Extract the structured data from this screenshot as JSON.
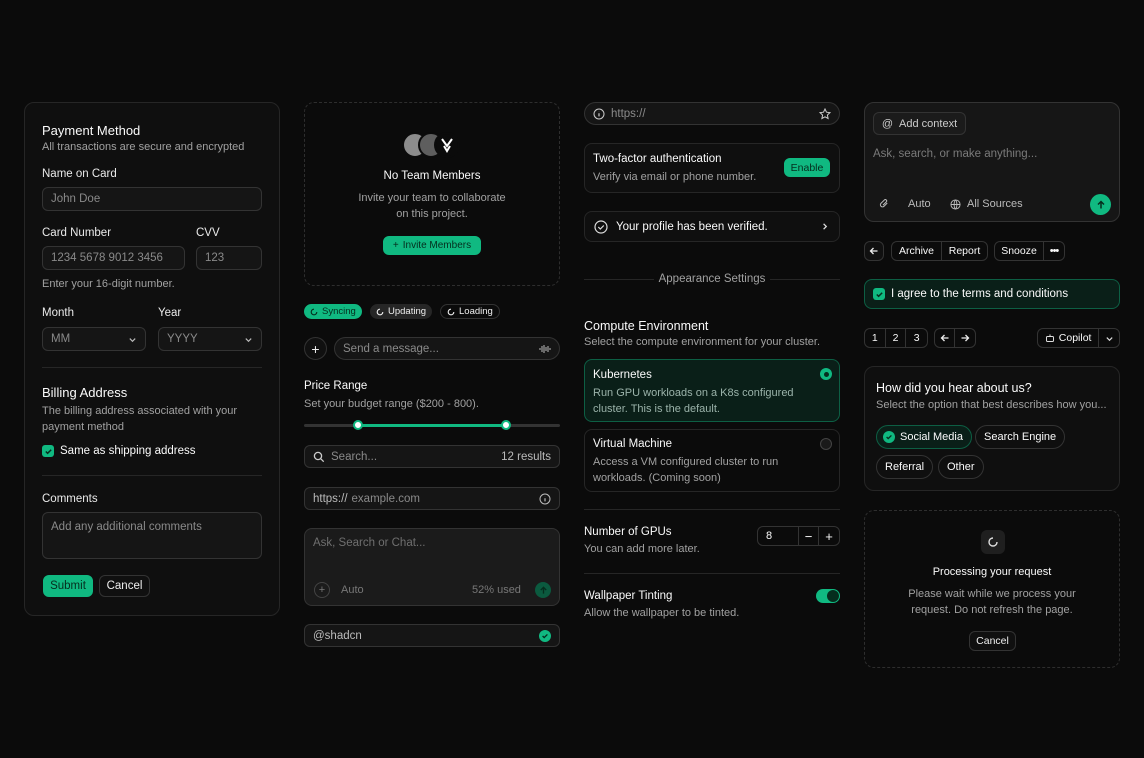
{
  "payment": {
    "title": "Payment Method",
    "subtitle": "All transactions are secure and encrypted",
    "name_label": "Name on Card",
    "name_placeholder": "John Doe",
    "card_label": "Card Number",
    "card_placeholder": "1234 5678 9012 3456",
    "cvv_label": "CVV",
    "cvv_placeholder": "123",
    "card_hint": "Enter your 16-digit number.",
    "month_label": "Month",
    "month_value": "MM",
    "year_label": "Year",
    "year_value": "YYYY",
    "billing_title": "Billing Address",
    "billing_subtitle": "The billing address associated with your payment method",
    "same_shipping": "Same as shipping address",
    "comments_label": "Comments",
    "comments_placeholder": "Add any additional comments",
    "submit": "Submit",
    "cancel": "Cancel"
  },
  "team": {
    "title": "No Team Members",
    "desc": "Invite your team to collaborate on this project.",
    "invite": "Invite Members"
  },
  "status": {
    "syncing": "Syncing",
    "updating": "Updating",
    "loading": "Loading"
  },
  "message": {
    "placeholder": "Send a message..."
  },
  "price": {
    "title": "Price Range",
    "desc": "Set your budget range ($200 - 800).",
    "low": 200,
    "high": 800,
    "min": 0,
    "max": 1000
  },
  "search": {
    "placeholder": "Search...",
    "results": "12 results"
  },
  "url_input": {
    "prefix": "https://",
    "placeholder": "example.com"
  },
  "chat": {
    "placeholder": "Ask, Search or Chat...",
    "mode": "Auto",
    "usage": "52% used"
  },
  "username": {
    "value": "@shadcn"
  },
  "urlbar": {
    "value": "https://"
  },
  "twofa": {
    "title": "Two-factor authentication",
    "desc": "Verify via email or phone number.",
    "enable": "Enable"
  },
  "verified": {
    "text": "Your profile has been verified."
  },
  "appearance": {
    "title": "Appearance Settings"
  },
  "compute": {
    "title": "Compute Environment",
    "desc": "Select the compute environment for your cluster.",
    "options": [
      {
        "title": "Kubernetes",
        "desc": "Run GPU workloads on a K8s configured cluster. This is the default.",
        "selected": true
      },
      {
        "title": "Virtual Machine",
        "desc": "Access a VM configured cluster to run workloads. (Coming soon)",
        "selected": false
      }
    ]
  },
  "gpus": {
    "title": "Number of GPUs",
    "desc": "You can add more later.",
    "value": "8"
  },
  "wallpaper": {
    "title": "Wallpaper Tinting",
    "desc": "Allow the wallpaper to be tinted.",
    "enabled": true
  },
  "prompt": {
    "context": "Add context",
    "placeholder": "Ask, search, or make anything...",
    "mode": "Auto",
    "sources": "All Sources"
  },
  "toolbar": {
    "archive": "Archive",
    "report": "Report",
    "snooze": "Snooze"
  },
  "terms": {
    "text": "I agree to the terms and conditions"
  },
  "pagination": {
    "pages": [
      "1",
      "2",
      "3"
    ],
    "copilot": "Copilot"
  },
  "survey": {
    "title": "How did you hear about us?",
    "desc": "Select the option that best describes how you...",
    "options": [
      "Social Media",
      "Search Engine",
      "Referral",
      "Other"
    ]
  },
  "processing": {
    "title": "Processing your request",
    "desc": "Please wait while we process your request. Do not refresh the page.",
    "cancel": "Cancel"
  },
  "colors": {
    "accent": "#10b981",
    "background": "#0b0b0b",
    "card": "#0f0f0f",
    "border": "#262626"
  }
}
